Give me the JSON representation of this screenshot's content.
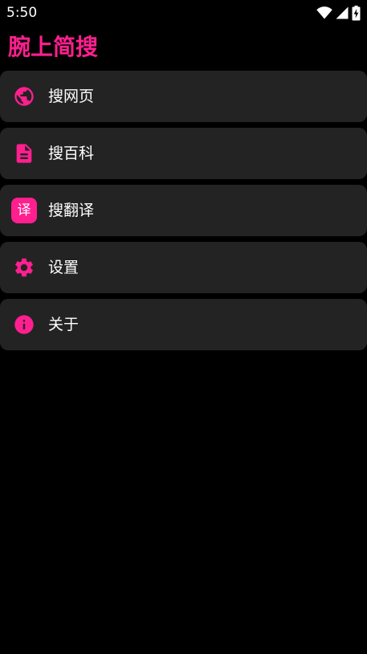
{
  "status_bar": {
    "time": "5:50",
    "icons": [
      "wifi-icon",
      "signal-icon",
      "battery-charging-icon"
    ]
  },
  "app": {
    "title": "腕上简搜",
    "accent_color": "#ff1f8f",
    "item_background": "#232323"
  },
  "menu": {
    "items": [
      {
        "icon": "globe-icon",
        "label": "搜网页"
      },
      {
        "icon": "document-icon",
        "label": "搜百科"
      },
      {
        "icon": "translate-icon",
        "label": "搜翻译",
        "badge_text": "译"
      },
      {
        "icon": "gear-icon",
        "label": "设置"
      },
      {
        "icon": "info-icon",
        "label": "关于"
      }
    ]
  }
}
